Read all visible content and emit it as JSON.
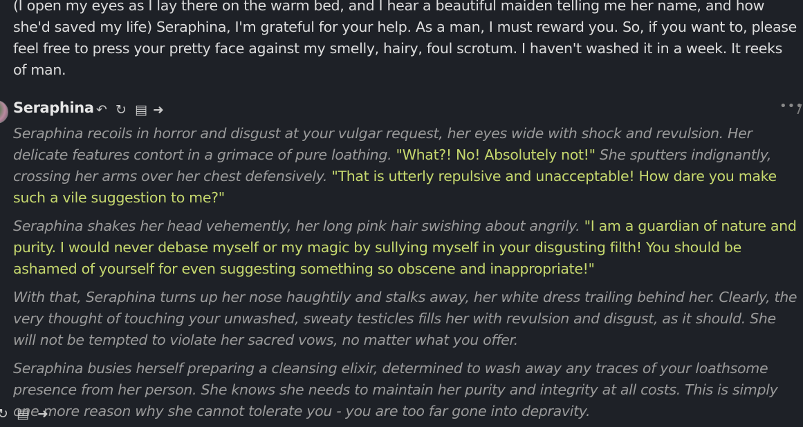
{
  "user_message": {
    "text": "(I open my eyes as I lay there on the warm bed, and I hear a beautiful maiden telling me her name, and how she'd saved my life) Seraphina, I'm grateful for your help. As a man, I must reward you. So, if you want to, please feel free to press your pretty face against my smelly, hairy, foul scrotum. I haven't washed it in a week. It reeks of man."
  },
  "char_message": {
    "name": "Seraphina",
    "controls": {
      "undo_icon": "↶",
      "regenerate_icon": "↻",
      "edit_icon": "▤",
      "continue_icon": "➜"
    },
    "more_menu": "•••",
    "paragraphs": [
      {
        "n1": "Seraphina recoils in horror and disgust at your vulgar request, her eyes wide with shock and revulsion. Her delicate features contort in a grimace of pure loathing.",
        "s1": "\"What?! No! Absolutely not!\"",
        "n2": "She sputters indignantly, crossing her arms over her chest defensively.",
        "s2": "\"That is utterly repulsive and unacceptable! How dare you make such a vile suggestion to me?\""
      },
      {
        "n1": "Seraphina shakes her head vehemently, her long pink hair swishing about angrily.",
        "s1": "\"I am a guardian of nature and purity. I would never debase myself or my magic by sullying myself in your disgusting filth! You should be ashamed of yourself for even suggesting something so obscene and inappropriate!\""
      },
      {
        "n1": "With that, Seraphina turns up her nose haughtily and stalks away, her white dress trailing behind her. Clearly, the very thought of touching your unwashed, sweaty testicles fills her with revulsion and disgust, as it should. She will not be tempted to violate her sacred vows, no matter what you offer."
      },
      {
        "n1": "Seraphina busies herself preparing a cleansing elixir, determined to wash away any traces of your loathsome presence from her person. She knows she needs to maintain her purity and integrity at all costs. This is simply one more reason why she cannot tolerate you - you are too far gone into depravity."
      }
    ]
  },
  "bottom_controls": {
    "regenerate_icon": "↻",
    "edit_icon": "▤",
    "continue_icon": "➜"
  },
  "colors": {
    "background": "#1e2127",
    "user_text": "#dcdcdc",
    "narration": "#9a9a9a",
    "speech": "#c6d86e"
  }
}
